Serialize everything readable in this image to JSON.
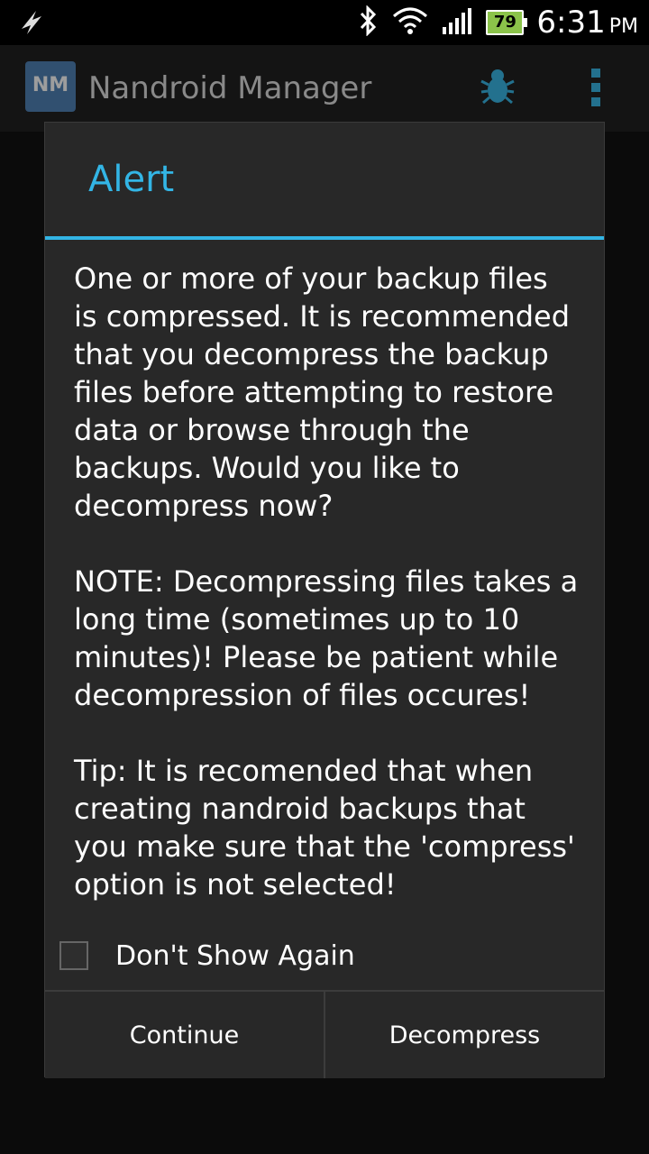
{
  "statusbar": {
    "time": "6:31",
    "ampm": "PM",
    "battery": "79"
  },
  "actionbar": {
    "app_icon_text": "NM",
    "title": "Nandroid Manager"
  },
  "dialog": {
    "title": "Alert",
    "message": "One or more of your backup files is compressed. It is recommended that you decompress the backup files before attempting to restore data or browse through the backups. Would you like to decompress now?\n\nNOTE: Decompressing files takes a long time (sometimes up to 10 minutes)! Please be patient while decompression of files occures!\n\nTip: It is recomended that when creating nandroid backups that you make sure that the 'compress' option is not selected!",
    "checkbox_label": "Don't Show Again",
    "checkbox_checked": false,
    "buttons": {
      "continue": "Continue",
      "decompress": "Decompress"
    }
  },
  "colors": {
    "accent": "#33b5e5",
    "dialog_bg": "#282828"
  }
}
